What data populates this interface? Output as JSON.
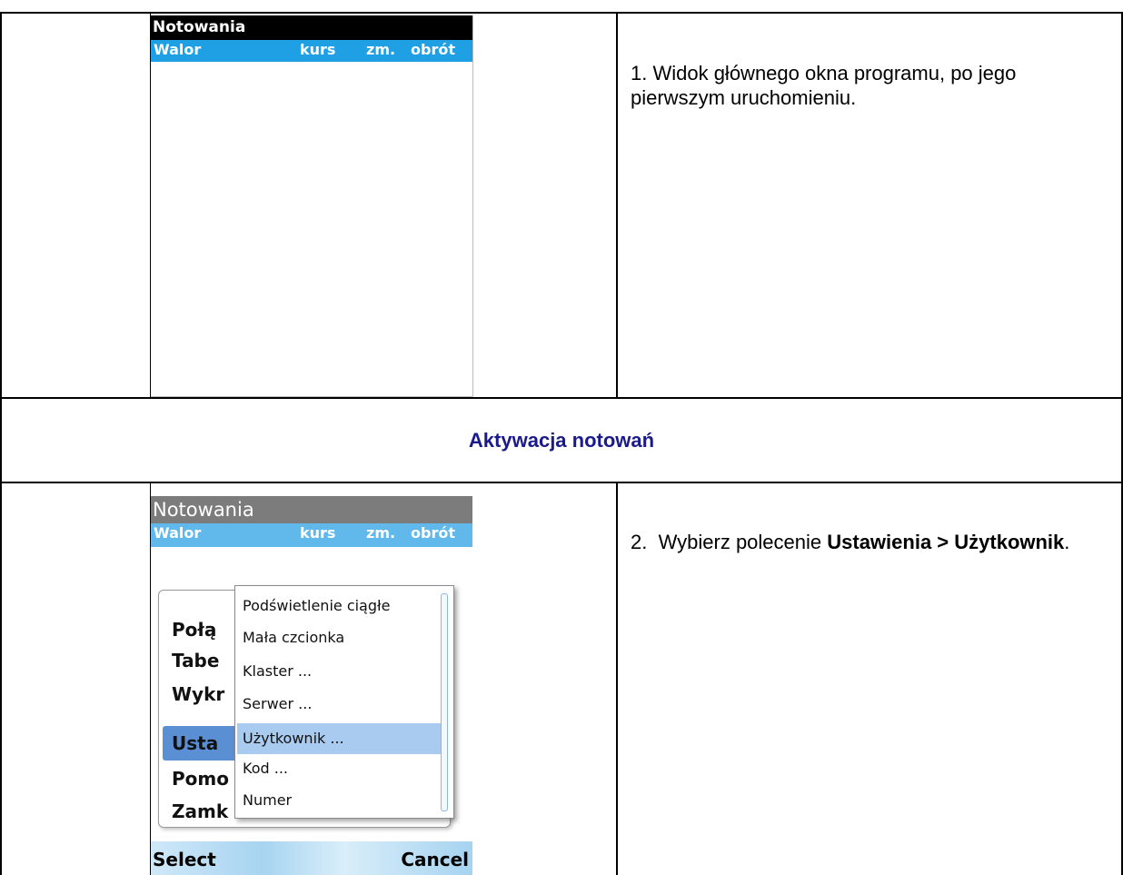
{
  "row1": {
    "phone": {
      "title": "Notowania",
      "columns": {
        "walor": "Walor",
        "kurs": "kurs",
        "zm": "zm.",
        "obrot": "obrót"
      }
    },
    "description": "1. Widok głównego okna programu, po jego pierwszym uruchomieniu."
  },
  "section_heading": "Aktywacja notowań",
  "row2": {
    "phone": {
      "title": "Notowania",
      "columns": {
        "walor": "Walor",
        "kurs": "kurs",
        "zm": "zm.",
        "obrot": "obrót"
      },
      "main_menu": [
        "Połą",
        "Tabe",
        "Wykr",
        "Usta",
        "Pomo",
        "Zamk"
      ],
      "main_menu_selected": "Usta",
      "submenu": [
        "Podświetlenie ciągłe",
        "Mała czcionka",
        "Klaster ...",
        "Serwer ...",
        "Użytkownik ...",
        "Kod ...",
        "Numer"
      ],
      "submenu_selected": "Użytkownik ...",
      "softkeys": {
        "left": "Select",
        "right": "Cancel"
      }
    },
    "description": {
      "prefix": "2.  Wybierz polecenie ",
      "bold": "Ustawienia > Użytkownik",
      "suffix": "."
    }
  },
  "colors": {
    "header_blue": "#1fa0e5",
    "heading_text": "#1a1a8c",
    "menu_highlight": "#5b8fd4",
    "submenu_highlight": "#a9cbef"
  }
}
